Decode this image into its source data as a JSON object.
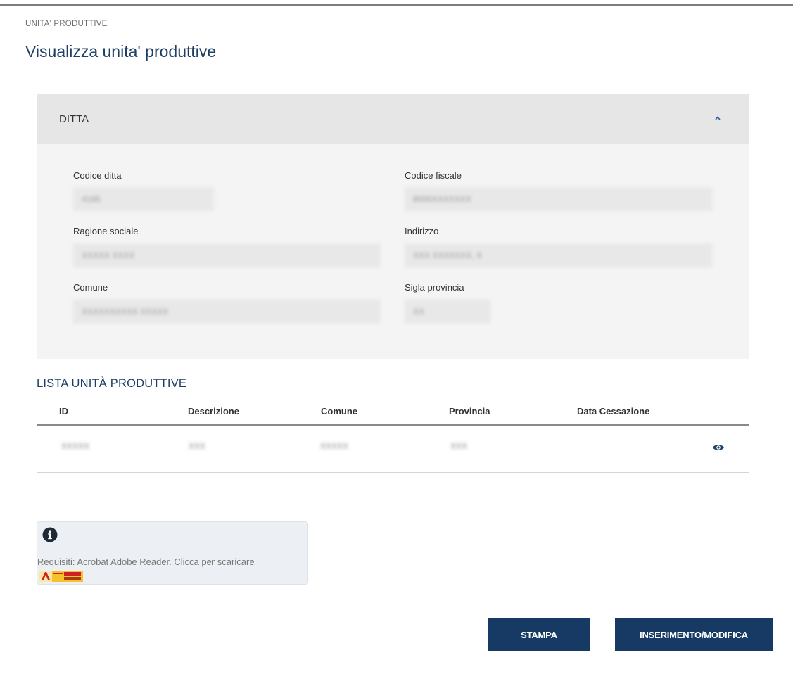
{
  "breadcrumb": "UNITA' PRODUTTIVE",
  "page_title": "Visualizza unita' produttive",
  "ditta": {
    "title": "DITTA",
    "fields": {
      "codice_ditta": {
        "label": "Codice ditta",
        "value": "4185"
      },
      "codice_fiscale": {
        "label": "Codice fiscale",
        "value": "8000XXXXXXX"
      },
      "ragione_sociale": {
        "label": "Ragione sociale",
        "value": "XXXXX XXXX"
      },
      "indirizzo": {
        "label": "Indirizzo",
        "value": "XXX XXXXXXX, X"
      },
      "comune": {
        "label": "Comune",
        "value": "XXXXXXXXXX XXXXX"
      },
      "sigla_provincia": {
        "label": "Sigla provincia",
        "value": "XX"
      }
    }
  },
  "lista": {
    "title": "LISTA UNITÀ PRODUTTIVE",
    "columns": [
      "ID",
      "Descrizione",
      "Comune",
      "Provincia",
      "Data Cessazione"
    ],
    "rows": [
      {
        "id": "XXXXX",
        "descrizione": "XXX",
        "comune": "XXXXX",
        "provincia": "XXX",
        "data_cessazione": ""
      }
    ]
  },
  "info": {
    "text": "Requisiti: Acrobat Adobe Reader. Clicca per scaricare"
  },
  "buttons": {
    "stampa": "STAMPA",
    "inserimento": "INSERIMENTO/MODIFICA"
  },
  "colors": {
    "primary": "#173a64",
    "title": "#1d3f66"
  },
  "icons": {
    "collapse": "chevron-up-icon",
    "view": "eye-icon",
    "info": "info-circle-icon",
    "adobe": "adobe-reader-badge"
  }
}
